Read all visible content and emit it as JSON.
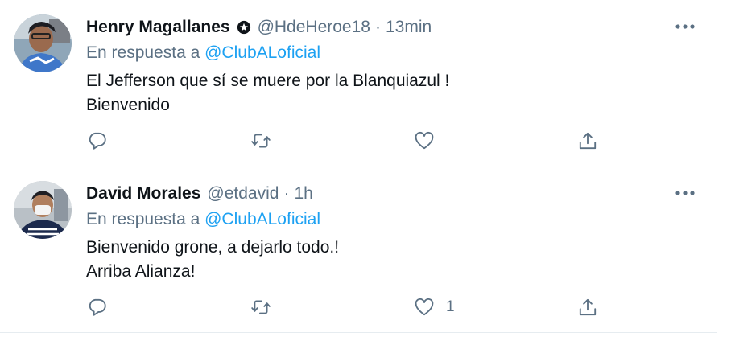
{
  "tweets": [
    {
      "author_name": "Henry Magallanes",
      "handle": "@HdeHeroe18",
      "separator": "·",
      "time": "13min",
      "reply_prefix": "En respuesta a",
      "reply_to": "@ClubALoficial",
      "text_lines": [
        "El Jefferson que sí se muere por la Blanquiazul !",
        "Bienvenido"
      ],
      "like_count": "",
      "has_badge": true
    },
    {
      "author_name": "David Morales",
      "handle": "@etdavid",
      "separator": "·",
      "time": "1h",
      "reply_prefix": "En respuesta a",
      "reply_to": "@ClubALoficial",
      "text_lines": [
        "Bienvenido grone, a dejarlo todo.!",
        "Arriba Alianza!"
      ],
      "like_count": "1",
      "has_badge": false
    }
  ],
  "icons": {
    "badge": "star-badge-icon",
    "more": "more-dots-icon",
    "reply": "reply-bubble-icon",
    "retweet": "retweet-icon",
    "like": "heart-icon",
    "share": "share-icon"
  },
  "colors": {
    "text": "#0f1419",
    "secondary": "#5b7083",
    "link": "#1da1f2",
    "divider": "#e6ecf0"
  }
}
